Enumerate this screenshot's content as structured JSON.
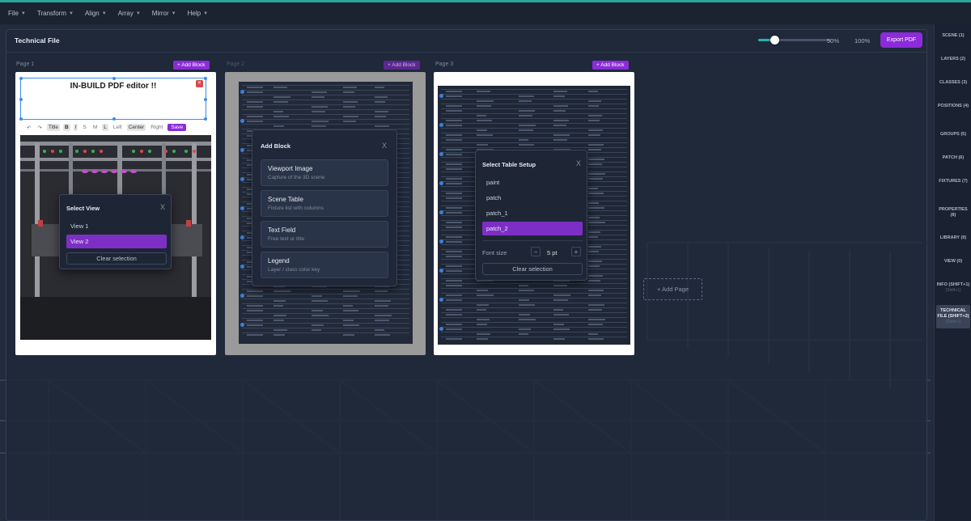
{
  "menu": [
    {
      "label": "File"
    },
    {
      "label": "Transform"
    },
    {
      "label": "Align"
    },
    {
      "label": "Array"
    },
    {
      "label": "Mirror"
    },
    {
      "label": "Help"
    }
  ],
  "panel": {
    "title": "Technical File",
    "zoom_value_percent": 50,
    "zoom_label_50": "50%",
    "zoom_label_100": "100%",
    "export_label": "Export PDF"
  },
  "pages": [
    {
      "label": "Page 1",
      "add_block": "+ Add Block"
    },
    {
      "label": "Page 2",
      "add_block": "+ Add Block"
    },
    {
      "label": "Page 3",
      "add_block": "+ Add Block"
    }
  ],
  "text_block": {
    "text": "IN-BUILD PDF editor !!"
  },
  "format_bar": {
    "undo": "↶",
    "redo": "↷",
    "title": "Title",
    "bold": "B",
    "italic": "I",
    "s": "S",
    "m": "M",
    "l": "L",
    "left": "Left",
    "center": "Center",
    "right": "Right",
    "save": "Save"
  },
  "select_view": {
    "title": "Select View",
    "close": "X",
    "options": [
      "View 1",
      "View 2"
    ],
    "selected_index": 1,
    "clear": "Clear selection"
  },
  "add_block_modal": {
    "title": "Add Block",
    "close": "X",
    "items": [
      {
        "title": "Viewport Image",
        "desc": "Capture of the 3D scene"
      },
      {
        "title": "Scene Table",
        "desc": "Fixture list with columns"
      },
      {
        "title": "Text Field",
        "desc": "Free text or title"
      },
      {
        "title": "Legend",
        "desc": "Layer / class color key"
      }
    ]
  },
  "table_setup": {
    "title": "Select Table Setup",
    "close": "X",
    "options": [
      "paint",
      "patch",
      "patch_1",
      "patch_2"
    ],
    "selected_index": 3,
    "font_size_label": "Font size",
    "font_size_value": "5 pt",
    "minus": "−",
    "plus": "+",
    "clear": "Clear selection"
  },
  "add_page": "+ Add Page",
  "sidebar": [
    {
      "label": "SCENE (1)",
      "hint": "(1)"
    },
    {
      "label": "LAYERS (2)",
      "hint": "(2)"
    },
    {
      "label": "CLASSES (3)",
      "hint": "(3)"
    },
    {
      "label": "POSITIONS (4)",
      "hint": "(4)"
    },
    {
      "label": "GROUPS (5)",
      "hint": "(5)"
    },
    {
      "label": "PATCH (6)",
      "hint": "(6)"
    },
    {
      "label": "FIXTURES (7)",
      "hint": "(7)"
    },
    {
      "label": "PROPERTIES (8)",
      "hint": "(8)"
    },
    {
      "label": "LIBRARY (9)",
      "hint": "(9)"
    },
    {
      "label": "VIEW (0)",
      "hint": ""
    },
    {
      "label": "INFO (SHIFT+1)",
      "hint": "(Shift+1)"
    },
    {
      "label": "TECHNICAL FILE (SHIFT+2)",
      "hint": "(Shift+2)"
    }
  ],
  "colors": {
    "accent_purple": "#8b2bd9",
    "accent_teal": "#23b5a8",
    "selection_blue": "#3a8ee8"
  }
}
